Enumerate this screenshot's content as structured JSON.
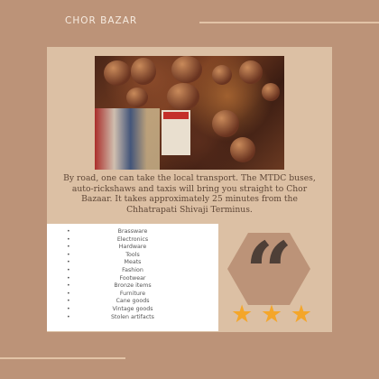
{
  "header": {
    "title": "CHOR BAZAR"
  },
  "description": "By road, one can take the local transport. The MTDC buses, auto-rickshaws and taxis will bring you straight to Chor Bazaar. It takes approximately 25 minutes from the Chhatrapati Shivaji Terminus.",
  "items": [
    "Brassware",
    "Electronics",
    "Hardware",
    "Tools",
    "Meats",
    "Fashion",
    "Footwear",
    "Bronze items",
    "Furniture",
    "Cane goods",
    "Vintage goods",
    "Stolen artifacts"
  ],
  "bullet": "•",
  "quote_glyph": "“",
  "rating": {
    "stars": 3,
    "glyph": "★"
  },
  "colors": {
    "background": "#bc9378",
    "panel": "#dcc0a4",
    "star": "#f4a62a"
  }
}
